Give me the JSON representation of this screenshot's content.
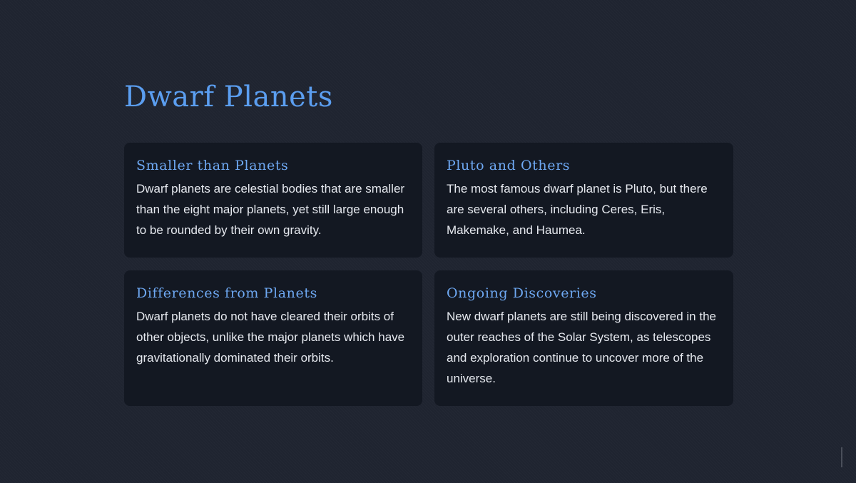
{
  "slide": {
    "title": "Dwarf Planets"
  },
  "cards": [
    {
      "title": "Smaller than Planets",
      "body": "Dwarf planets are celestial bodies that are smaller than the eight major planets, yet still large enough to be rounded by their own gravity."
    },
    {
      "title": "Pluto and Others",
      "body": "The most famous dwarf planet is Pluto, but there are several others, including Ceres, Eris, Makemake, and Haumea."
    },
    {
      "title": "Differences from Planets",
      "body": "Dwarf planets do not have cleared their orbits of other objects, unlike the major planets which have gravitationally dominated their orbits."
    },
    {
      "title": "Ongoing Discoveries",
      "body": "New dwarf planets are still being discovered in the outer reaches of the Solar System, as telescopes and exploration continue to uncover more of the universe."
    }
  ],
  "colors": {
    "background": "#1f2430",
    "card": "#131822",
    "accent": "#5b9ef0",
    "text": "#e6e9ef"
  }
}
